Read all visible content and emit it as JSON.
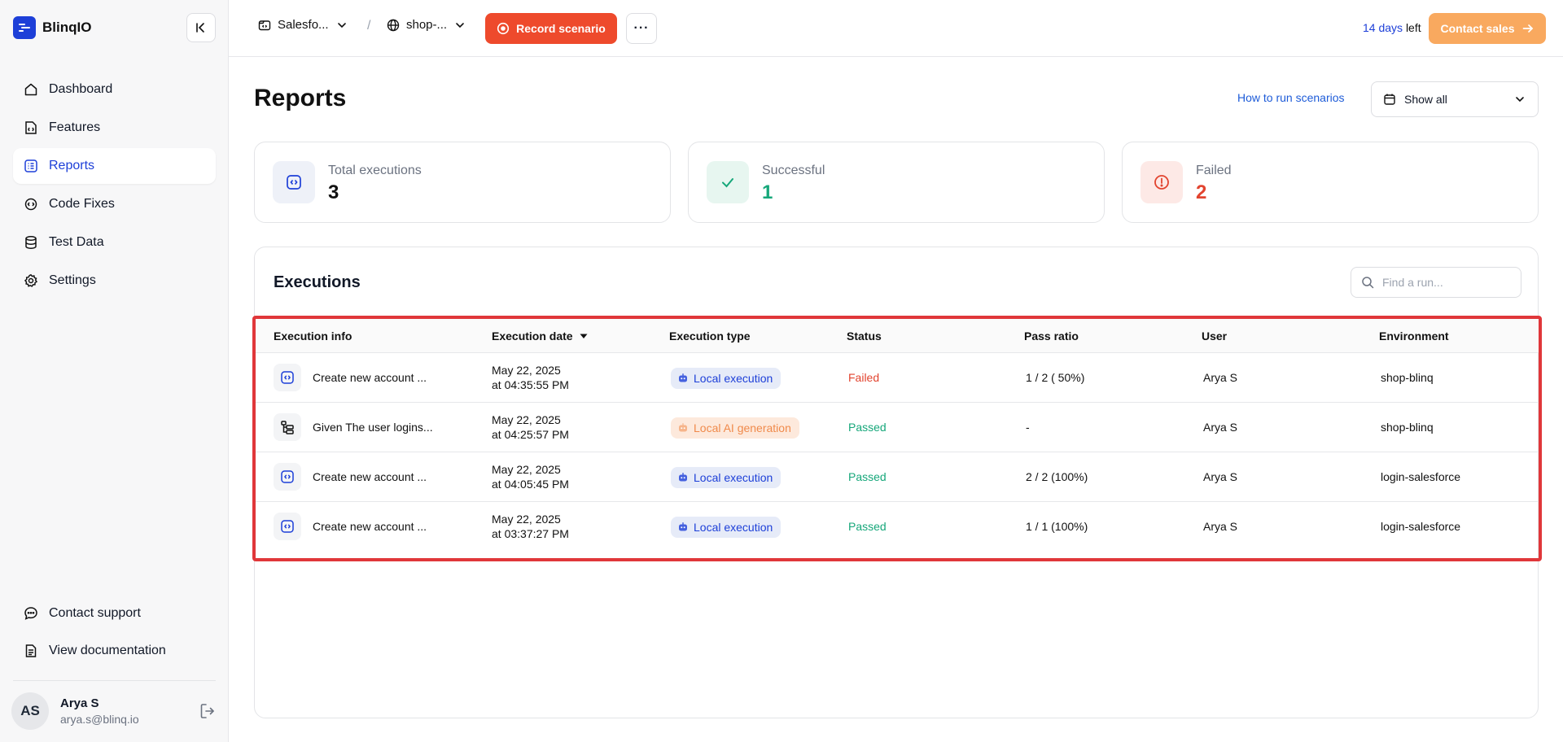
{
  "app": {
    "name": "BlinqIO"
  },
  "sidebar": {
    "items": [
      {
        "label": "Dashboard",
        "icon": "home-icon"
      },
      {
        "label": "Features",
        "icon": "features-icon"
      },
      {
        "label": "Reports",
        "icon": "reports-icon",
        "active": true
      },
      {
        "label": "Code Fixes",
        "icon": "code-fixes-icon"
      },
      {
        "label": "Test Data",
        "icon": "database-icon"
      },
      {
        "label": "Settings",
        "icon": "gear-icon"
      }
    ],
    "bottom": [
      {
        "label": "Contact support",
        "icon": "chat-icon"
      },
      {
        "label": "View documentation",
        "icon": "document-icon"
      }
    ],
    "user": {
      "initials": "AS",
      "name": "Arya S",
      "email": "arya.s@blinq.io"
    }
  },
  "topbar": {
    "project": "Salesfo...",
    "environment": "shop-...",
    "record_label": "Record scenario",
    "more_label": "···",
    "trial_days": "14 days",
    "trial_suffix": "left",
    "contact_label": "Contact sales"
  },
  "page": {
    "title": "Reports",
    "howto_link": "How to run scenarios",
    "filter_value": "Show all"
  },
  "stats": {
    "total": {
      "label": "Total executions",
      "value": "3"
    },
    "success": {
      "label": "Successful",
      "value": "1"
    },
    "failed": {
      "label": "Failed",
      "value": "2"
    }
  },
  "executions": {
    "title": "Executions",
    "search_placeholder": "Find a run...",
    "columns": [
      "Execution info",
      "Execution date",
      "Execution type",
      "Status",
      "Pass ratio",
      "User",
      "Environment"
    ],
    "rows": [
      {
        "info": "Create new account ...",
        "date1": "May 22, 2025",
        "date2": "at 04:35:55 PM",
        "type": "Local execution",
        "status": "Failed",
        "ratio": "1 / 2 ( 50%)",
        "user": "Arya S",
        "env": "shop-blinq"
      },
      {
        "info": "Given The user logins...",
        "date1": "May 22, 2025",
        "date2": "at 04:25:57 PM",
        "type": "Local AI generation",
        "status": "Passed",
        "ratio": "-",
        "user": "Arya S",
        "env": "shop-blinq"
      },
      {
        "info": "Create new account ...",
        "date1": "May 22, 2025",
        "date2": "at 04:05:45 PM",
        "type": "Local execution",
        "status": "Passed",
        "ratio": "2 / 2 (100%)",
        "user": "Arya S",
        "env": "login-salesforce"
      },
      {
        "info": "Create new account ...",
        "date1": "May 22, 2025",
        "date2": "at 03:37:27 PM",
        "type": "Local execution",
        "status": "Passed",
        "ratio": "1 / 1 (100%)",
        "user": "Arya S",
        "env": "login-salesforce"
      }
    ]
  },
  "colors": {
    "brand": "#1d3fd8",
    "record": "#ee4a2c",
    "contact": "#f9a95f",
    "success": "#16a77a",
    "failed": "#e2442f",
    "highlight": "#e0373a"
  }
}
